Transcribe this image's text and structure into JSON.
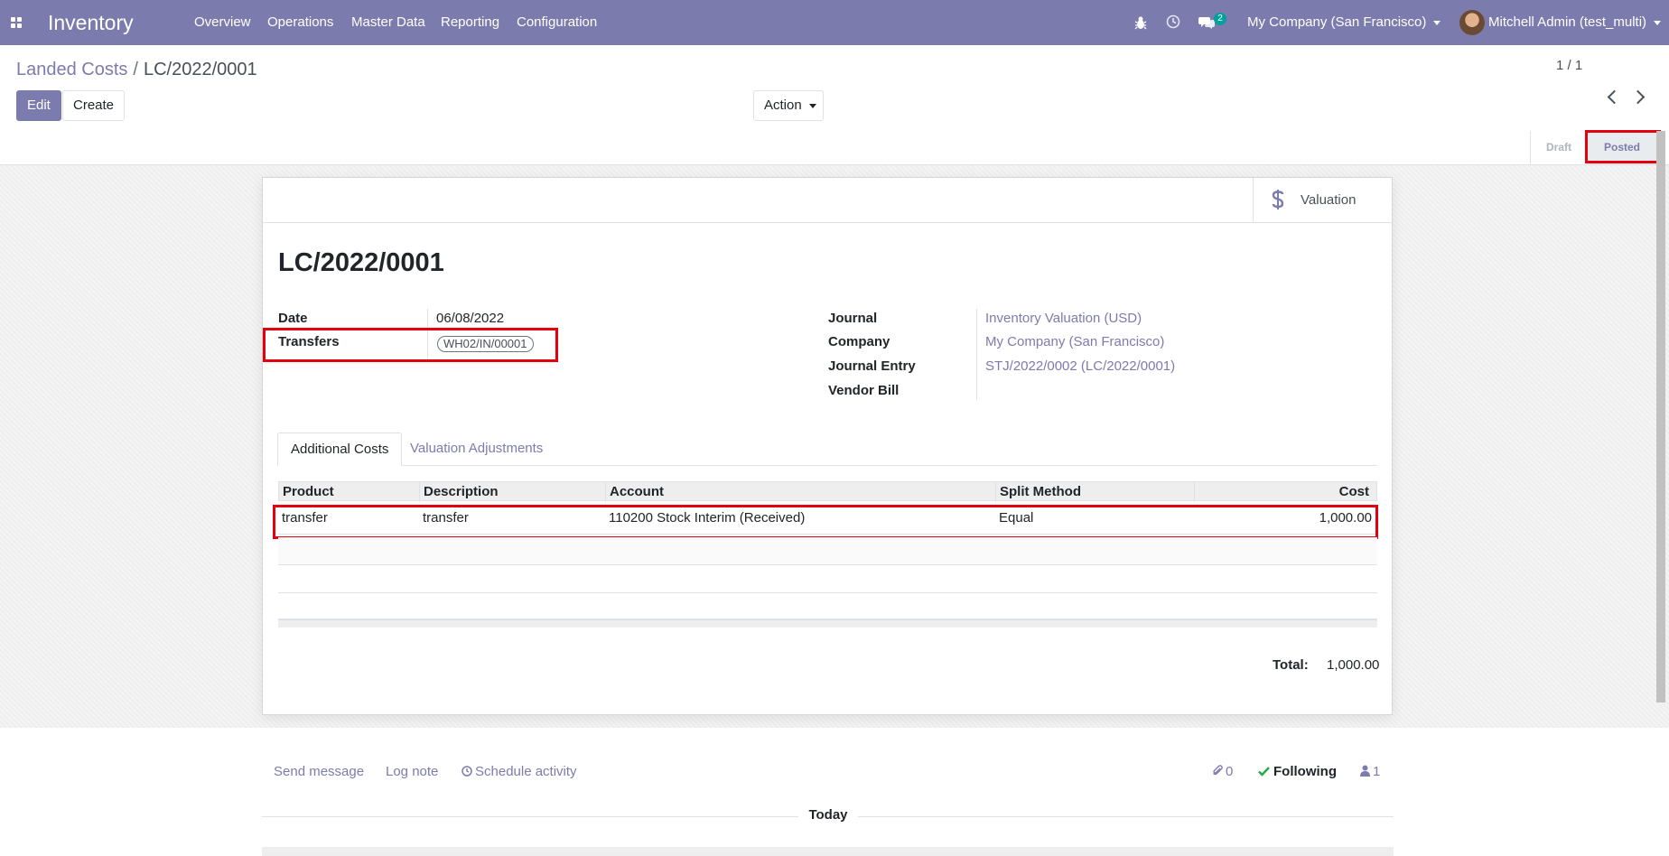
{
  "navbar": {
    "app_name": "Inventory",
    "menu": [
      "Overview",
      "Operations",
      "Master Data",
      "Reporting",
      "Configuration"
    ],
    "message_count": "2",
    "company": "My Company (San Francisco)",
    "user": "Mitchell Admin (test_multi)",
    "color": "#7c7bad"
  },
  "breadcrumb": {
    "parent": "Landed Costs",
    "current": "LC/2022/0001"
  },
  "toolbar": {
    "edit_label": "Edit",
    "create_label": "Create",
    "action_label": "Action",
    "pager": "1 / 1"
  },
  "statusbar": {
    "stages": [
      "Draft",
      "Posted"
    ],
    "current": "Posted"
  },
  "button_box": {
    "valuation_label": "Valuation",
    "valuation_icon": "dollar-icon"
  },
  "form": {
    "title": "LC/2022/0001",
    "left": {
      "date_label": "Date",
      "date_value": "06/08/2022",
      "transfers_label": "Transfers",
      "transfers_tag": "WH02/IN/00001"
    },
    "right": {
      "journal_label": "Journal",
      "journal_value": "Inventory Valuation (USD)",
      "company_label": "Company",
      "company_value": "My Company (San Francisco)",
      "journal_entry_label": "Journal Entry",
      "journal_entry_value": "STJ/2022/0002 (LC/2022/0001)",
      "vendor_bill_label": "Vendor Bill"
    },
    "tabs": [
      "Additional Costs",
      "Valuation Adjustments"
    ],
    "table": {
      "columns": [
        "Product",
        "Description",
        "Account",
        "Split Method",
        "Cost"
      ],
      "rows": [
        [
          "transfer",
          "transfer",
          "110200 Stock Interim (Received)",
          "Equal",
          "1,000.00"
        ]
      ]
    },
    "total_label": "Total:",
    "total_value": "1,000.00"
  },
  "chatter": {
    "send_message": "Send message",
    "log_note": "Log note",
    "schedule_activity": "Schedule activity",
    "attachments": "0",
    "following": "Following",
    "followers": "1",
    "today": "Today"
  }
}
